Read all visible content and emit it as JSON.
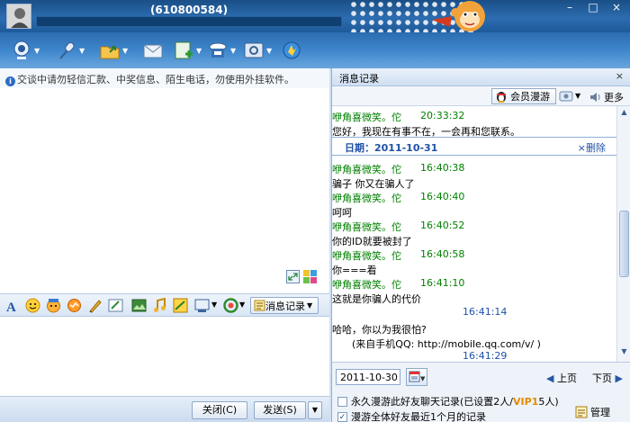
{
  "window": {
    "title": "(610800584)",
    "controls": [
      "–",
      "□",
      "×"
    ]
  },
  "toolbar": {
    "icons": [
      "webcam-icon",
      "microphone-icon",
      "send-file-icon",
      "send-email-icon",
      "add-app-icon",
      "remote-assist-icon",
      "settings-icon",
      "app-box-icon"
    ]
  },
  "chat": {
    "notice": "交谈中请勿轻信汇款、中奖信息、陌生电话，勿使用外挂软件。"
  },
  "format_bar": {
    "icons": [
      "font-icon",
      "emoji-icon",
      "magic-emoji-icon",
      "vibrate-icon",
      "handwriting-icon",
      "screenshot-icon",
      "image-icon",
      "music-icon",
      "doodle-icon",
      "screen-capture-icon",
      "scene-icon"
    ],
    "history_button": "消息记录"
  },
  "buttons": {
    "close": "关闭(C)",
    "send": "发送(S)",
    "send_dropdown": "▼"
  },
  "history": {
    "title": "消息记录",
    "close_symbol": "×",
    "vip_button": "会员漫游",
    "more": "更多",
    "entries": [
      {
        "sender": "咿角喜微笑。佗",
        "time": "20:33:32",
        "text": "您好，我现在有事不在，一会再和您联系。"
      },
      {
        "date": "日期：2011-10-31",
        "delete": "×删除"
      },
      {
        "sender": "咿角喜微笑。佗",
        "time": "16:40:38",
        "text": "骗子 你又在骗人了"
      },
      {
        "sender": "咿角喜微笑。佗",
        "time": "16:40:40",
        "text": "呵呵"
      },
      {
        "sender": "咿角喜微笑。佗",
        "time": "16:40:52",
        "text": "你的ID就要被封了"
      },
      {
        "sender": "咿角喜微笑。佗",
        "time": "16:40:58",
        "text": "你===看"
      },
      {
        "sender": "咿角喜微笑。佗",
        "time": "16:41:10",
        "text": "这就是你骗人的代价"
      },
      {
        "self_time": "16:41:14",
        "text": "哈哈，你以为我很怕?",
        "text2": "(来自手机QQ: http://mobile.qq.com/v/ )"
      },
      {
        "self_time": "16:41:29"
      }
    ],
    "footer": {
      "date": "2011-10-30",
      "prev_page": "上页",
      "next_page": "下页",
      "roam_label": "永久漫游此好友聊天记录(已设置2人/",
      "vip_label": "VIP1",
      "roam_suffix": "5人)",
      "roam_checked": false,
      "roam_all_label": "漫游全体好友最近1个月的记录",
      "roam_all_checked": true,
      "manage": "管理"
    }
  }
}
